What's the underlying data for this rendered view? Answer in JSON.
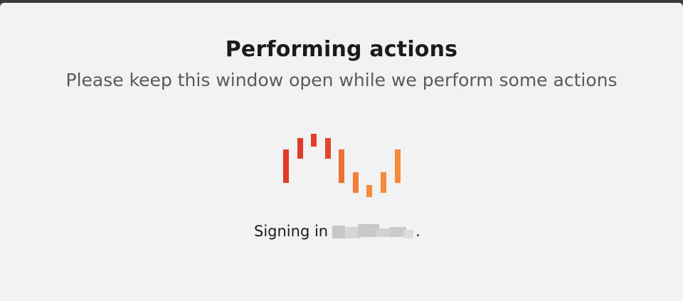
{
  "dialog": {
    "title": "Performing actions",
    "subtitle": "Please keep this window open while we perform some actions",
    "status_prefix": "Signing in",
    "status_suffix": "."
  },
  "loader": {
    "icon": "wave-bars-spinner-icon",
    "colors": [
      "#e03a2a",
      "#e03a2a",
      "#e2402c",
      "#e3462d",
      "#ef6e35",
      "#f27e37",
      "#f58a3a",
      "#f58a3a",
      "#f58a3a"
    ]
  }
}
